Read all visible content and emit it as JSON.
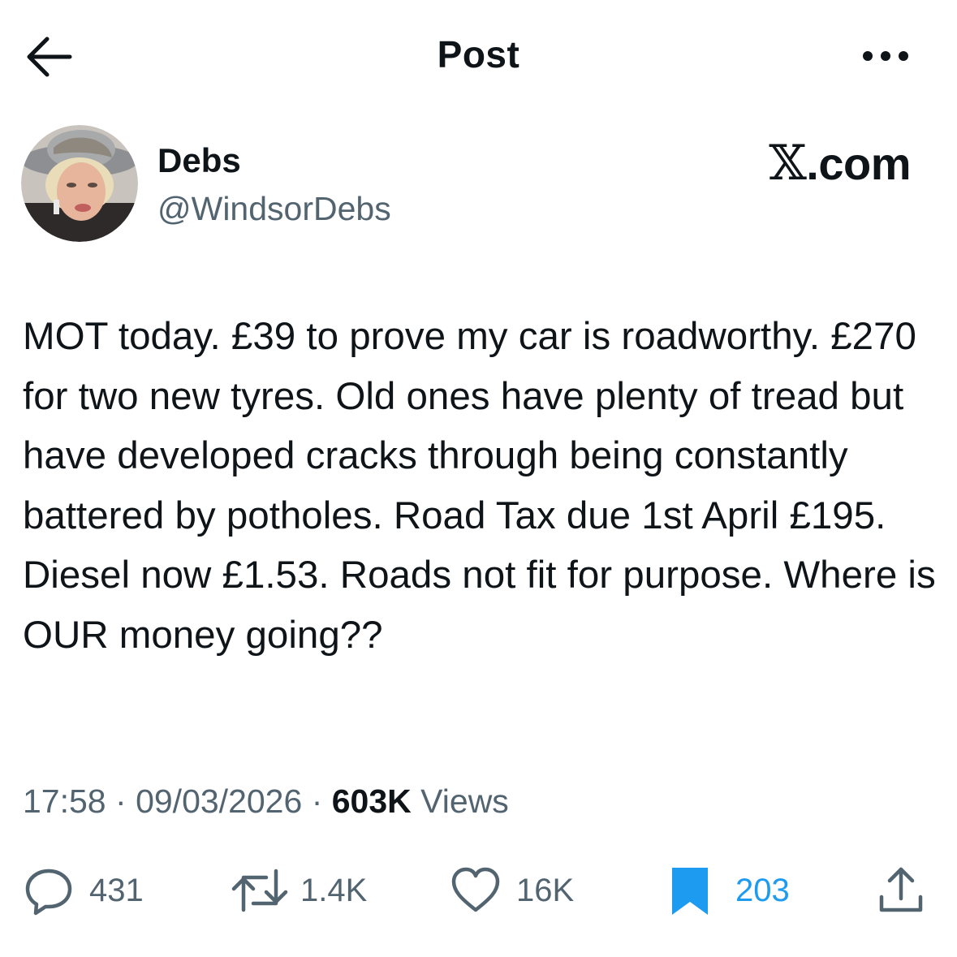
{
  "header": {
    "title": "Post",
    "back_icon": "arrow-left-icon",
    "more_icon": "more-horizontal-icon"
  },
  "author": {
    "display_name": "Debs",
    "handle": "@WindsorDebs",
    "avatar": "avatar-photo"
  },
  "brand": {
    "x_glyph": "𝕏",
    "domain": ".com"
  },
  "post": {
    "text": "MOT today. £39 to prove my car is roadworthy. £270 for two new tyres. Old ones have plenty of tread but have developed cracks through being constantly battered by potholes. Road Tax due 1st April £195. Diesel now £1.53. Roads not fit for purpose. Where is OUR money going??",
    "time": "17:58",
    "date": "09/03/2026",
    "separator": "·",
    "views_count": "603K",
    "views_label": "Views"
  },
  "actions": {
    "replies": "431",
    "reposts": "1.4K",
    "likes": "16K",
    "bookmarks": "203",
    "reply_icon": "reply-bubble-icon",
    "repost_icon": "repost-icon",
    "like_icon": "heart-icon",
    "bookmark_icon": "bookmark-filled-icon",
    "share_icon": "share-icon"
  },
  "colors": {
    "text_primary": "#0f1419",
    "text_secondary": "#536471",
    "accent": "#1d9bf0",
    "background": "#ffffff"
  }
}
